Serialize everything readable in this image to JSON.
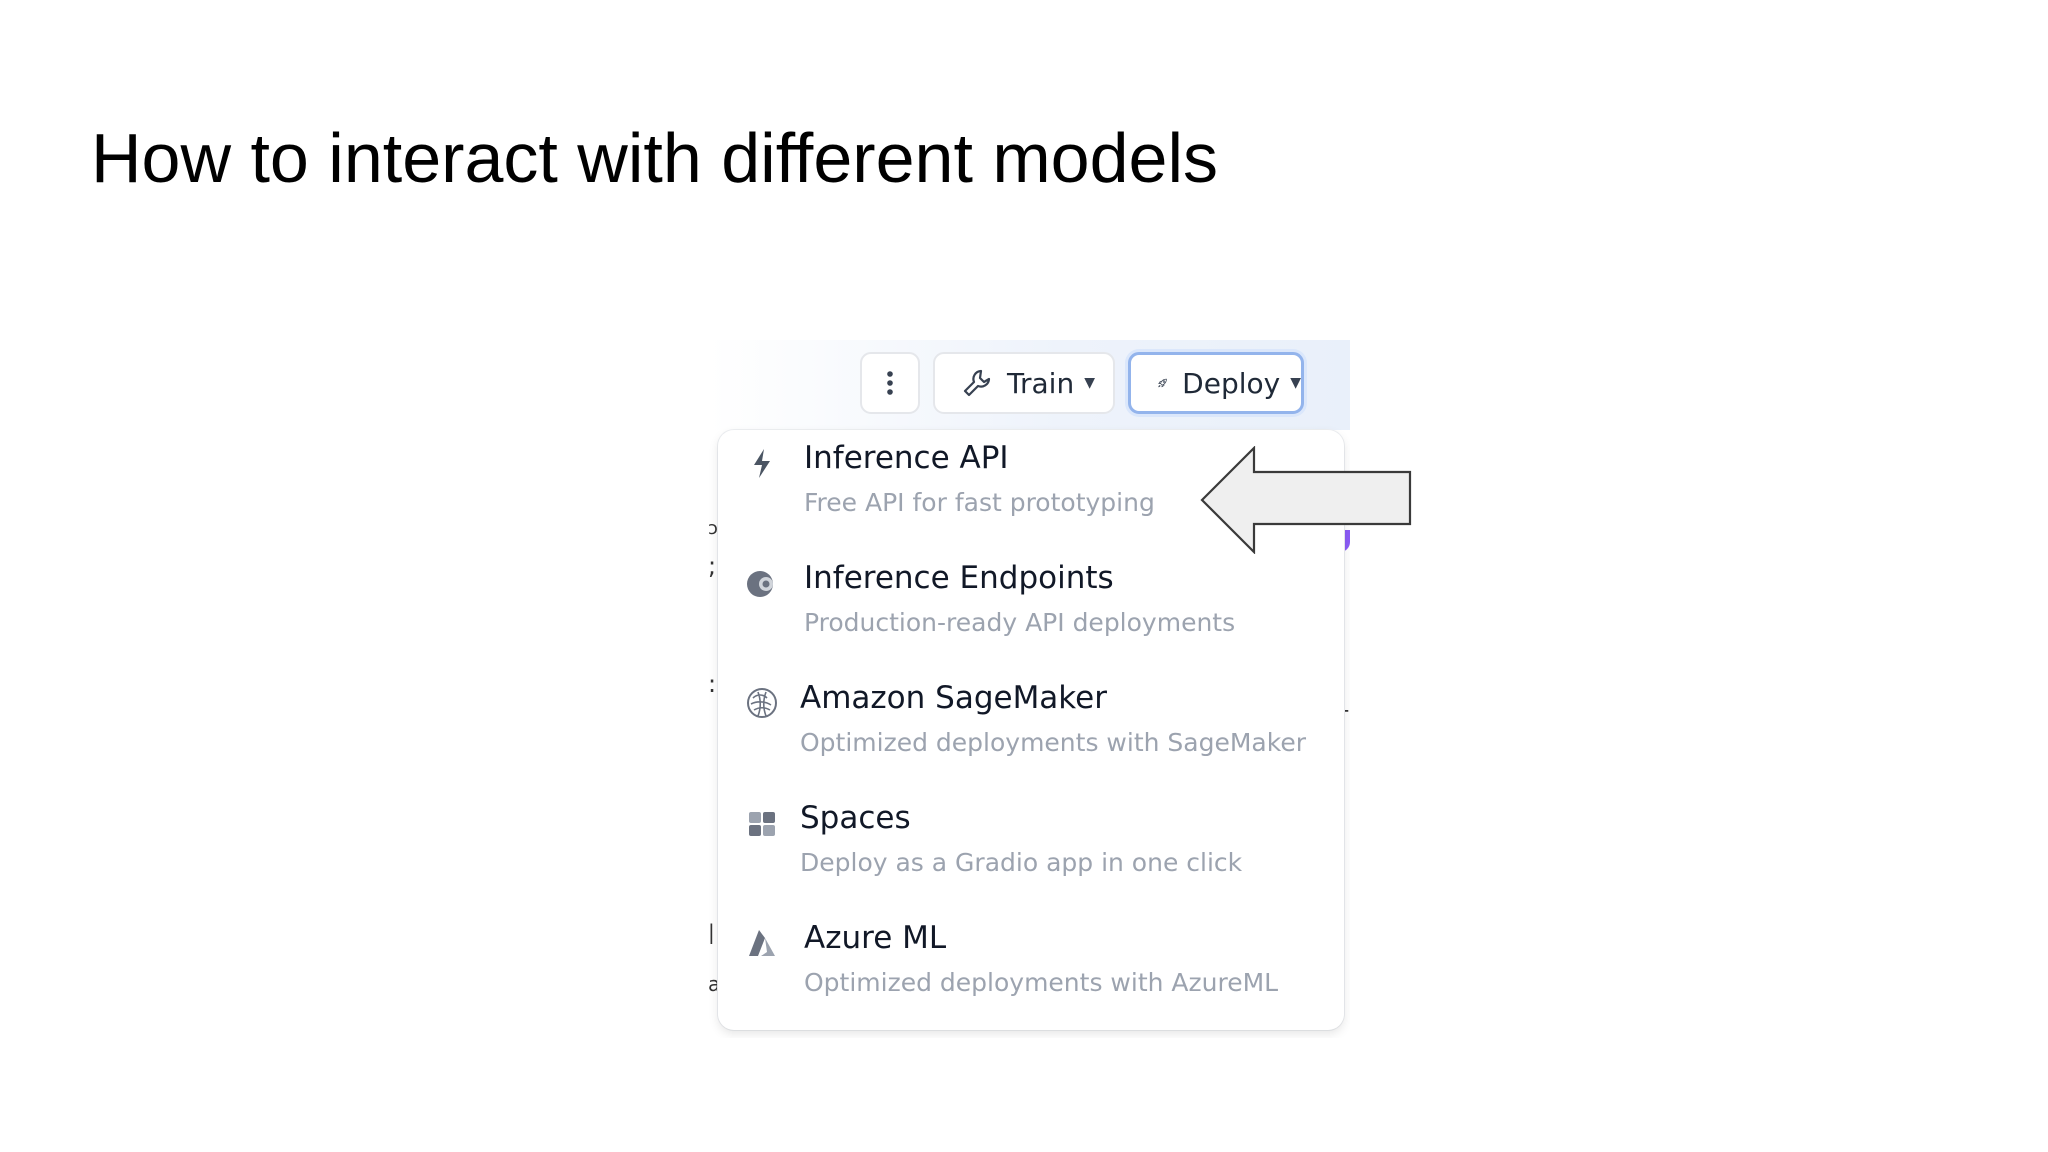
{
  "slide": {
    "title": "How to interact with different models"
  },
  "toolbar": {
    "more_icon": "vertical-ellipsis-icon",
    "train": {
      "label": "Train",
      "icon": "wrench-icon"
    },
    "deploy": {
      "label": "Deploy",
      "icon": "rocket-icon",
      "state": "open"
    }
  },
  "deploy_menu": {
    "items": [
      {
        "label": "Inference API",
        "description": "Free API for fast prototyping",
        "icon": "lightning-icon"
      },
      {
        "label": "Inference Endpoints",
        "description": "Production-ready API deployments",
        "icon": "endpoints-icon"
      },
      {
        "label": "Amazon SageMaker",
        "description": "Optimized deployments with SageMaker",
        "icon": "sagemaker-icon"
      },
      {
        "label": "Spaces",
        "description": "Deploy as a Gradio app in one click",
        "icon": "spaces-icon"
      },
      {
        "label": "Azure ML",
        "description": "Optimized deployments with AzureML",
        "icon": "azure-icon"
      }
    ]
  },
  "annotation": {
    "icon": "left-arrow-callout",
    "points_to": "Inference API"
  },
  "colors": {
    "deploy_focus_border": "#93b4ec",
    "description_text": "#9ca3af",
    "arrow_fill": "#efefef"
  }
}
